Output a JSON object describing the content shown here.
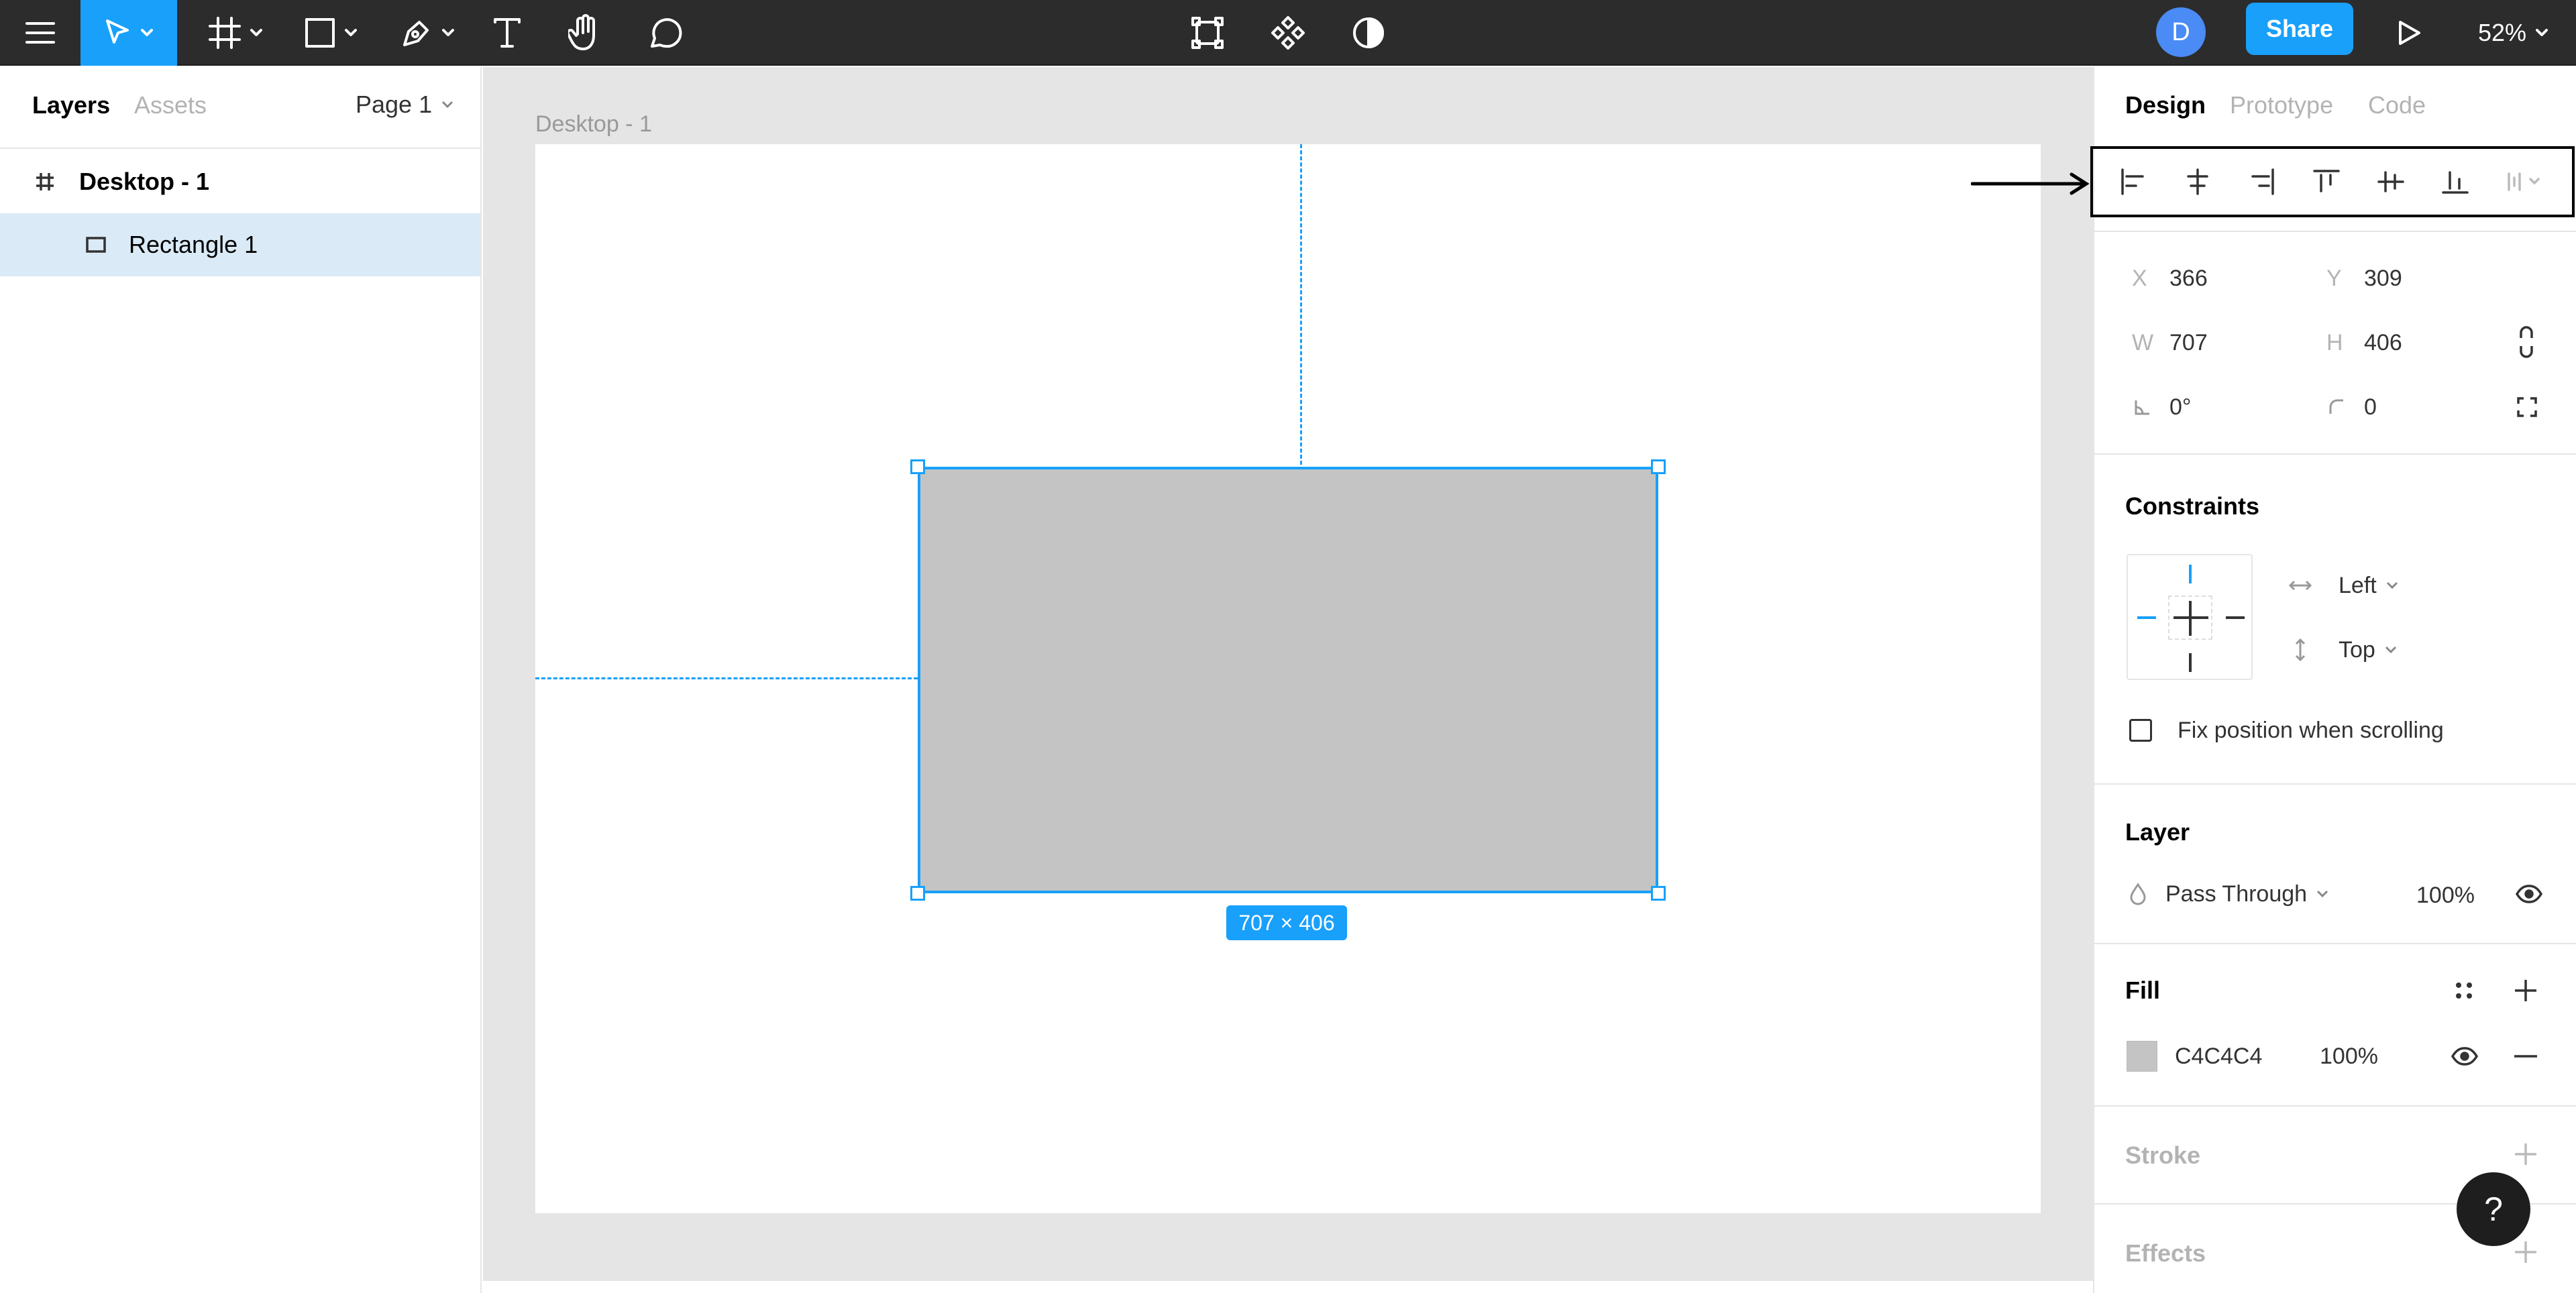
{
  "toolbar": {
    "zoom": "52%",
    "share_label": "Share",
    "avatar_initial": "D"
  },
  "left_panel": {
    "tabs": [
      "Layers",
      "Assets"
    ],
    "page_selector": "Page 1",
    "layers": [
      {
        "name": "Desktop - 1",
        "type": "frame"
      },
      {
        "name": "Rectangle 1",
        "type": "rectangle",
        "selected": true
      }
    ]
  },
  "canvas": {
    "frame_label": "Desktop - 1",
    "size_badge": "707 × 406",
    "rect_fill": "#c4c4c4",
    "selection_color": "#18a0fb"
  },
  "right_panel": {
    "tabs": [
      "Design",
      "Prototype",
      "Code"
    ],
    "x_label": "X",
    "x_value": "366",
    "y_label": "Y",
    "y_value": "309",
    "w_label": "W",
    "w_value": "707",
    "h_label": "H",
    "h_value": "406",
    "rotation_value": "0°",
    "radius_value": "0",
    "constraints_title": "Constraints",
    "h_constraint": "Left",
    "v_constraint": "Top",
    "fix_position_label": "Fix position when scrolling",
    "layer_title": "Layer",
    "blend_mode": "Pass Through",
    "layer_opacity": "100%",
    "fill_title": "Fill",
    "fill_hex": "C4C4C4",
    "fill_opacity": "100%",
    "fill_color": "#c4c4c4",
    "stroke_title": "Stroke",
    "effects_title": "Effects"
  },
  "colors": {
    "accent": "#18a0fb",
    "toolbar_bg": "#2c2c2c",
    "avatar": "#4a8bf5"
  }
}
